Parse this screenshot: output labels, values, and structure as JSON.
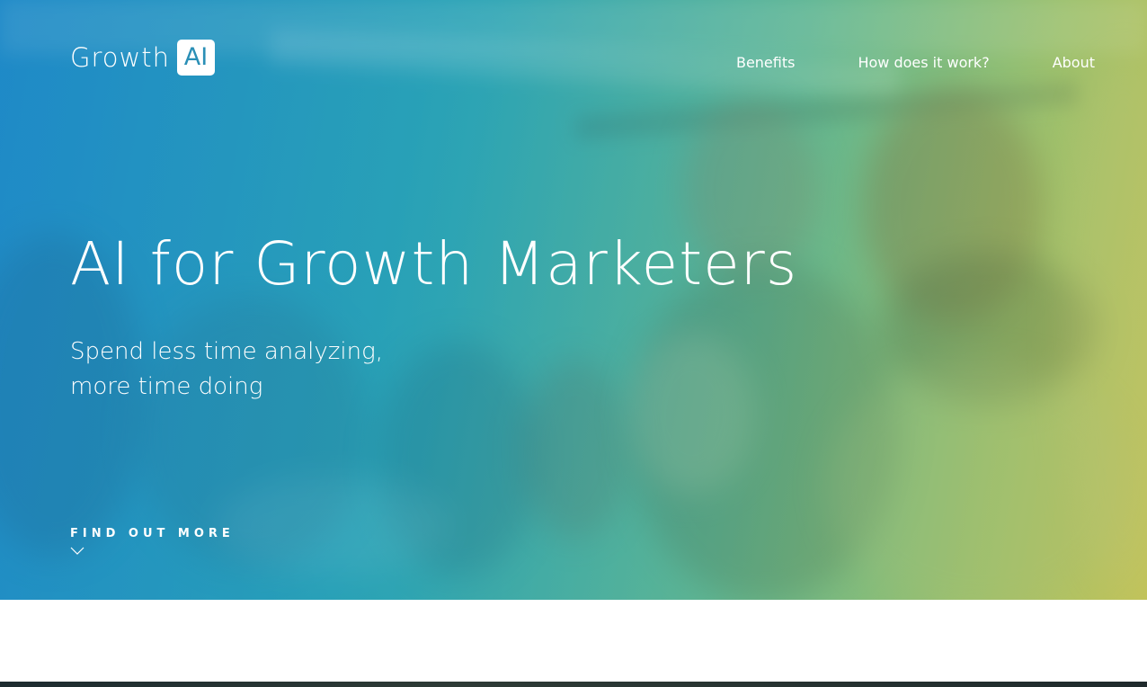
{
  "brand": {
    "word": "Growth",
    "box": "AI",
    "accent": "#2a8fb6"
  },
  "nav": {
    "items": [
      {
        "label": "Benefits"
      },
      {
        "label": "How does it work?"
      },
      {
        "label": "About"
      }
    ]
  },
  "hero": {
    "headline": "AI for Growth Marketers",
    "subline_1": "Spend less time analyzing,",
    "subline_2": "more time doing",
    "cta_label": "FIND OUT MORE",
    "cta_icon": "chevron-down-icon",
    "gradient_start": "#1f86c7",
    "gradient_end": "#c5c359"
  }
}
